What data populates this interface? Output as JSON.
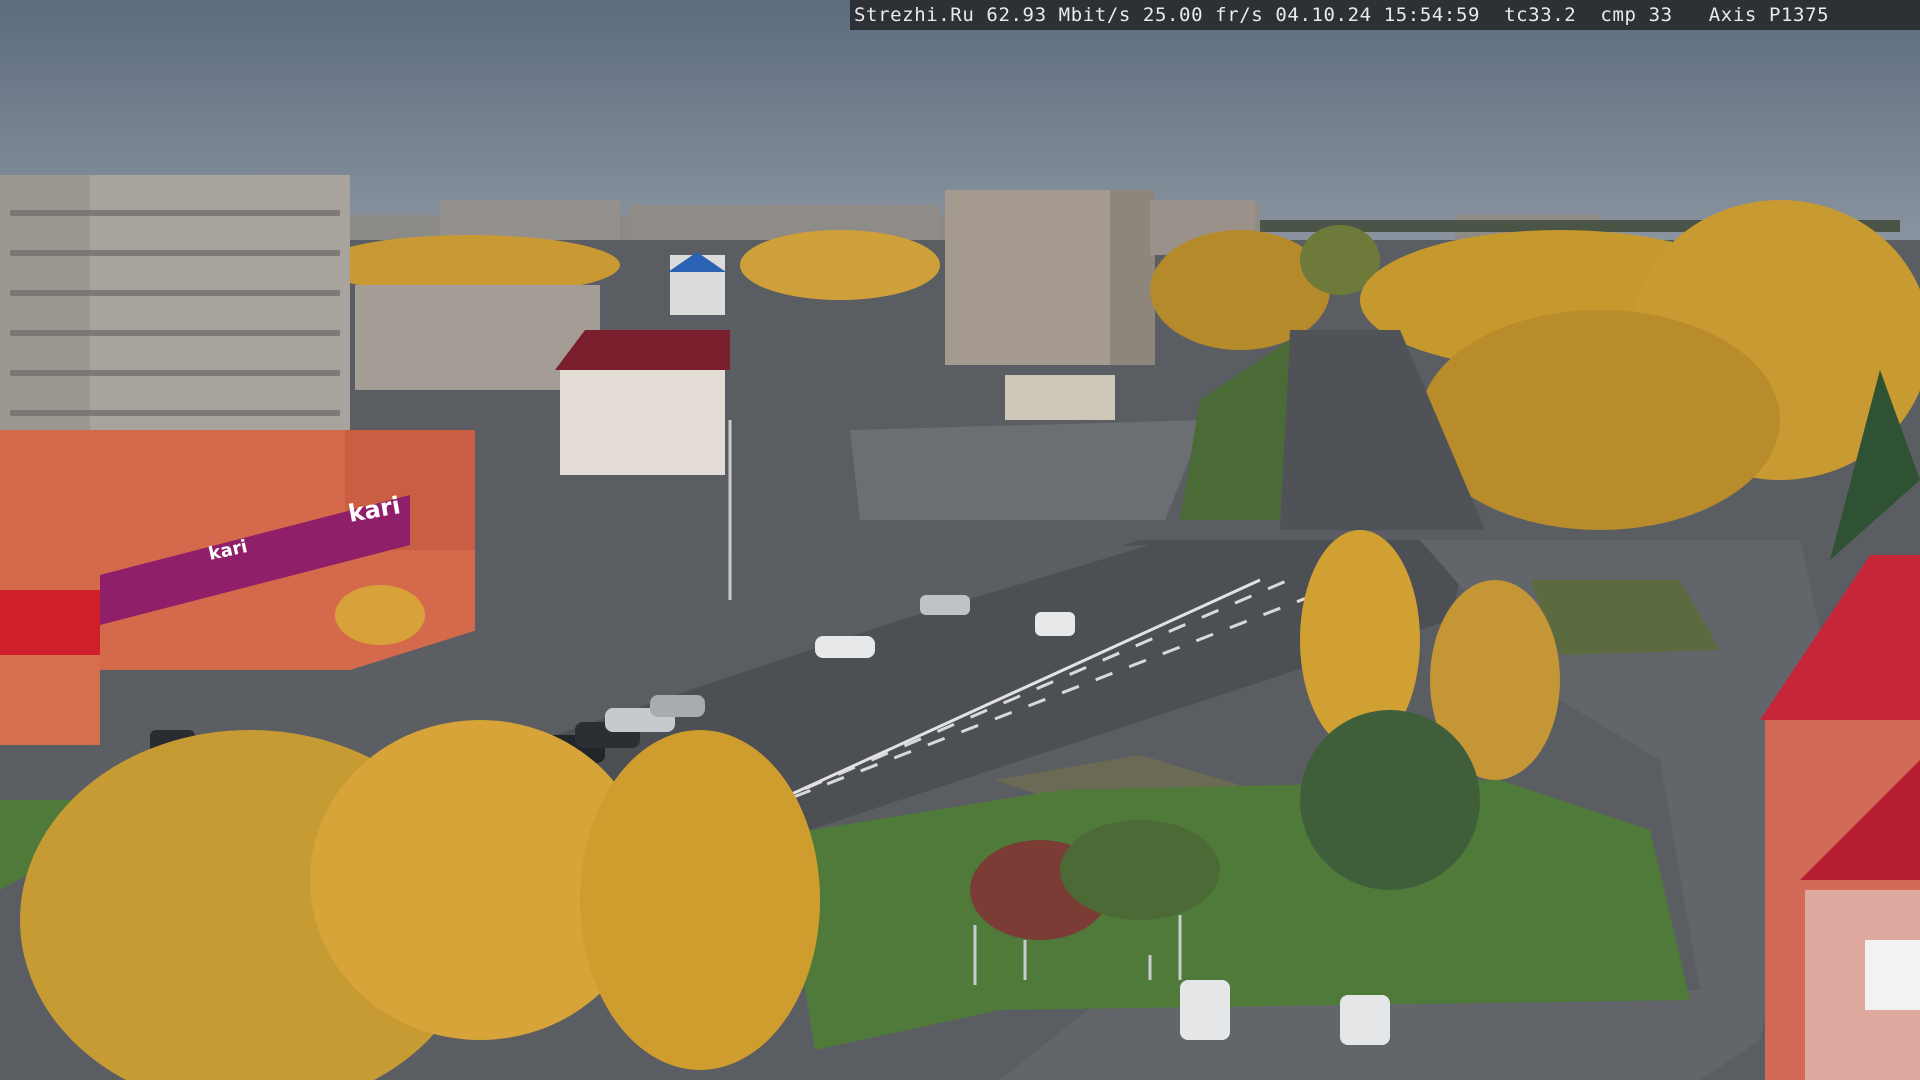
{
  "camera_overlay": {
    "text": "Strezhi.Ru 62.93 Mbit/s 25.00 fr/s 04.10.24 15:54:59  tc33.2  cmp 33   Axis P1375"
  },
  "store_signs": {
    "main": "kari",
    "small": "kari"
  },
  "colors": {
    "sky": "#6f7d8f",
    "asphalt": "#55595f",
    "autumn_foliage": "#d2a23a",
    "grass": "#4f7a3a",
    "store_facade": "#d8674a",
    "store_banner": "#9b1f6e"
  }
}
